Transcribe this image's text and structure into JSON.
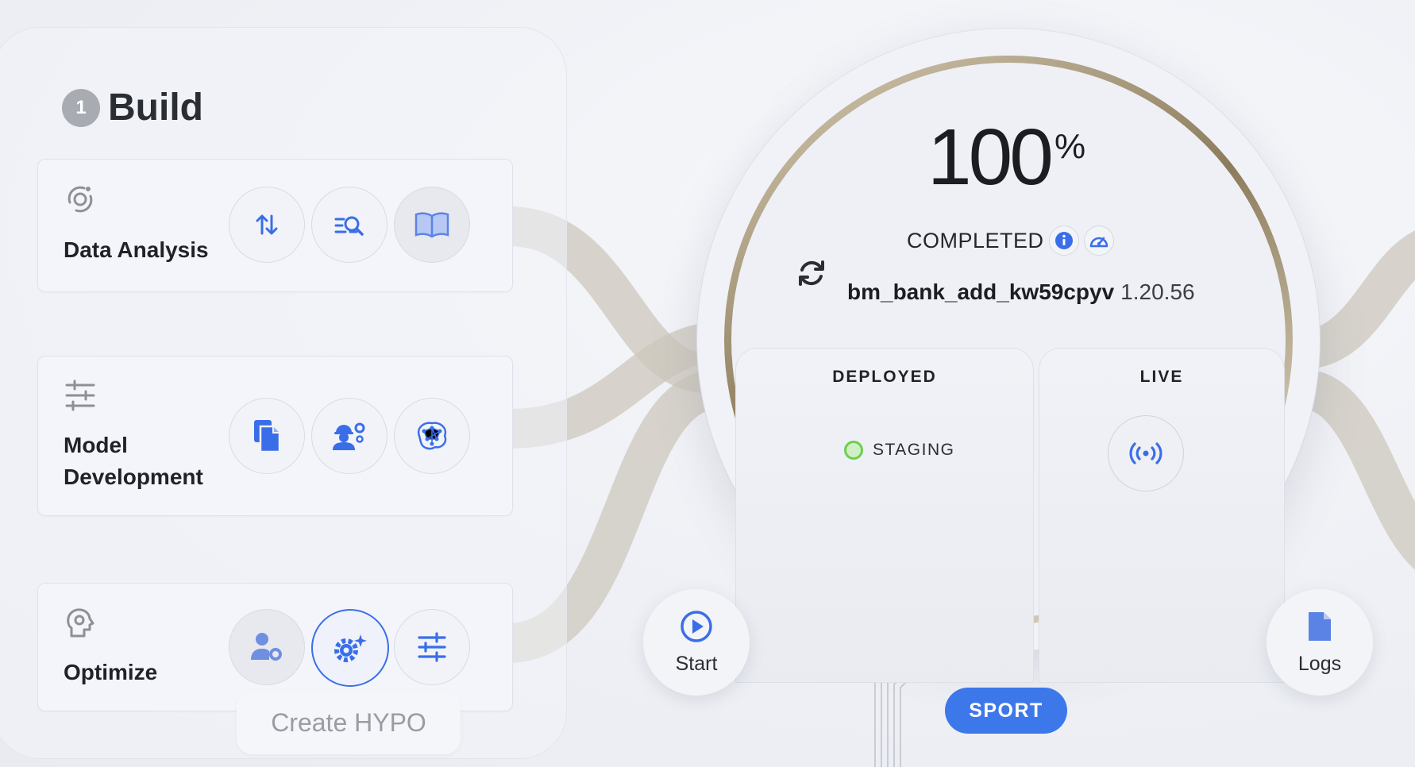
{
  "build": {
    "step_number": "1",
    "title": "Build",
    "cards": [
      {
        "title": "Data Analysis",
        "icon": "data-analysis-icon",
        "actions": [
          "sort-arrows-icon",
          "search-list-icon",
          "book-icon"
        ]
      },
      {
        "title_line1": "Model",
        "title_line2": "Development",
        "icon": "sliders-icon",
        "actions": [
          "documents-icon",
          "engineer-gear-icon",
          "neural-network-icon"
        ]
      },
      {
        "title": "Optimize",
        "icon": "head-gear-icon",
        "actions": [
          "user-gear-icon",
          "sparkle-gear-icon",
          "tune-sliders-icon"
        ],
        "active_action": "sparkle-gear-icon"
      }
    ],
    "create_hypo_label": "Create HYPO"
  },
  "status_dial": {
    "progress_value": "100",
    "progress_unit": "%",
    "progress_fraction": 1.0,
    "status": "COMPLETED",
    "model_name": "bm_bank_add_kw59cpyv",
    "model_version": "1.20.56",
    "deployed": {
      "title": "DEPLOYED",
      "environment": "STAGING",
      "status_color": "#6ccf4e"
    },
    "live": {
      "title": "LIVE",
      "icon": "broadcast-icon"
    }
  },
  "controls": {
    "start_label": "Start",
    "logs_label": "Logs",
    "sport_label": "SPORT"
  },
  "colors": {
    "accent": "#3c78ea",
    "ring_gold": "#8c7c5c",
    "ribbon": "#cbc6bc"
  }
}
